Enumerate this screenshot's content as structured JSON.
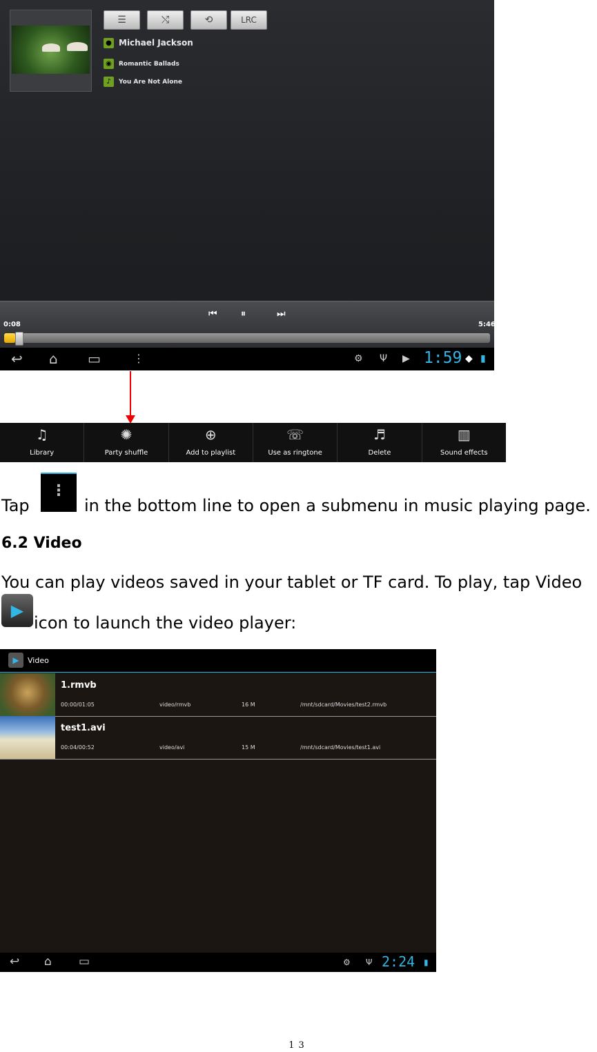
{
  "player": {
    "toolbar": {
      "lrc_label": "LRC"
    },
    "artist": "Michael Jackson",
    "album": "Romantic Ballads",
    "track": "You Are Not Alone",
    "time_current": "0:08",
    "time_total": "5:46",
    "progress_fraction": 0.023,
    "clock": "1:59",
    "accent_color": "#33b5e5",
    "progress_color": "#f0b400"
  },
  "submenu": {
    "items": [
      {
        "label": "Library",
        "icon": "music-note-icon"
      },
      {
        "label": "Party shuffle",
        "icon": "party-shuffle-icon"
      },
      {
        "label": "Add to playlist",
        "icon": "plus-circle-icon"
      },
      {
        "label": "Use as ringtone",
        "icon": "ringtone-icon"
      },
      {
        "label": "Delete",
        "icon": "delete-icon"
      },
      {
        "label": "Sound effects",
        "icon": "equalizer-icon"
      }
    ]
  },
  "text": {
    "tap_before": "Tap",
    "tap_after": "in the bottom line to open a submenu in music playing page.",
    "section_heading": "6.2 Video",
    "para_line1": "You can play videos saved in your tablet or TF card. To play, tap Video",
    "para_line2": "icon to launch the video player:"
  },
  "video_app": {
    "title": "Video",
    "rows": [
      {
        "name": "1.rmvb",
        "time": "00:00/01:05",
        "type": "video/rmvb",
        "size": "16 M",
        "path": "/mnt/sdcard/Movies/test2.rmvb"
      },
      {
        "name": "test1.avi",
        "time": "00:04/00:52",
        "type": "video/avi",
        "size": "15 M",
        "path": "/mnt/sdcard/Movies/test1.avi"
      }
    ],
    "clock": "2:24"
  },
  "page_number": "13"
}
